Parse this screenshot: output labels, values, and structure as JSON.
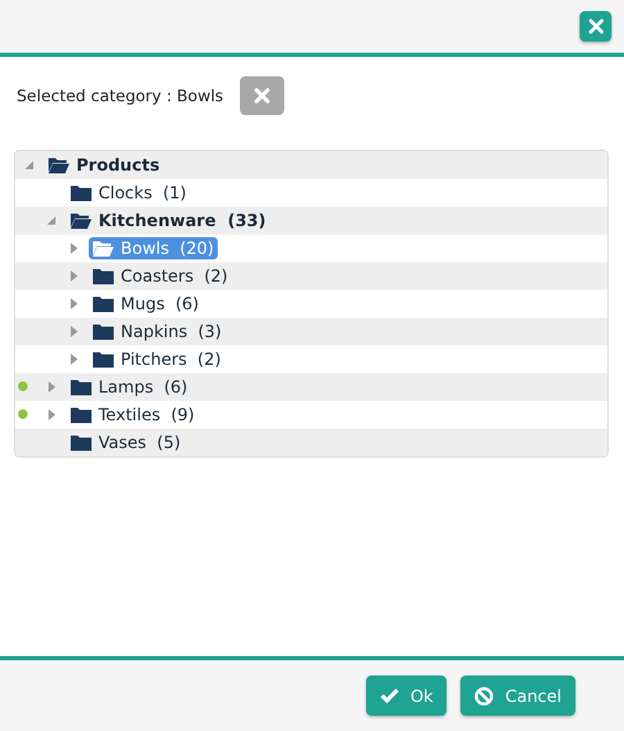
{
  "selected_category": {
    "label": "Selected category : Bowls"
  },
  "tree": [
    {
      "label": "Products",
      "expanded": true,
      "selected": false,
      "flagged": false,
      "children": [
        {
          "label": "Clocks  (1)",
          "selected": false,
          "flagged": false
        },
        {
          "label": "Kitchenware  (33)",
          "expanded": true,
          "selected": false,
          "flagged": false,
          "children": [
            {
              "label": "Bowls  (20)",
              "expanded": false,
              "selected": true,
              "flagged": false
            },
            {
              "label": "Coasters  (2)",
              "expanded": false,
              "selected": false,
              "flagged": false
            },
            {
              "label": "Mugs  (6)",
              "expanded": false,
              "selected": false,
              "flagged": false
            },
            {
              "label": "Napkins  (3)",
              "expanded": false,
              "selected": false,
              "flagged": false
            },
            {
              "label": "Pitchers  (2)",
              "expanded": false,
              "selected": false,
              "flagged": false
            }
          ]
        },
        {
          "label": "Lamps  (6)",
          "expanded": false,
          "selected": false,
          "flagged": true
        },
        {
          "label": "Textiles  (9)",
          "expanded": false,
          "selected": false,
          "flagged": true
        },
        {
          "label": "Vases  (5)",
          "selected": false,
          "flagged": false
        }
      ]
    }
  ],
  "buttons": [
    {
      "kind": "ok",
      "label": "Ok"
    },
    {
      "kind": "cancel",
      "label": "Cancel"
    }
  ]
}
